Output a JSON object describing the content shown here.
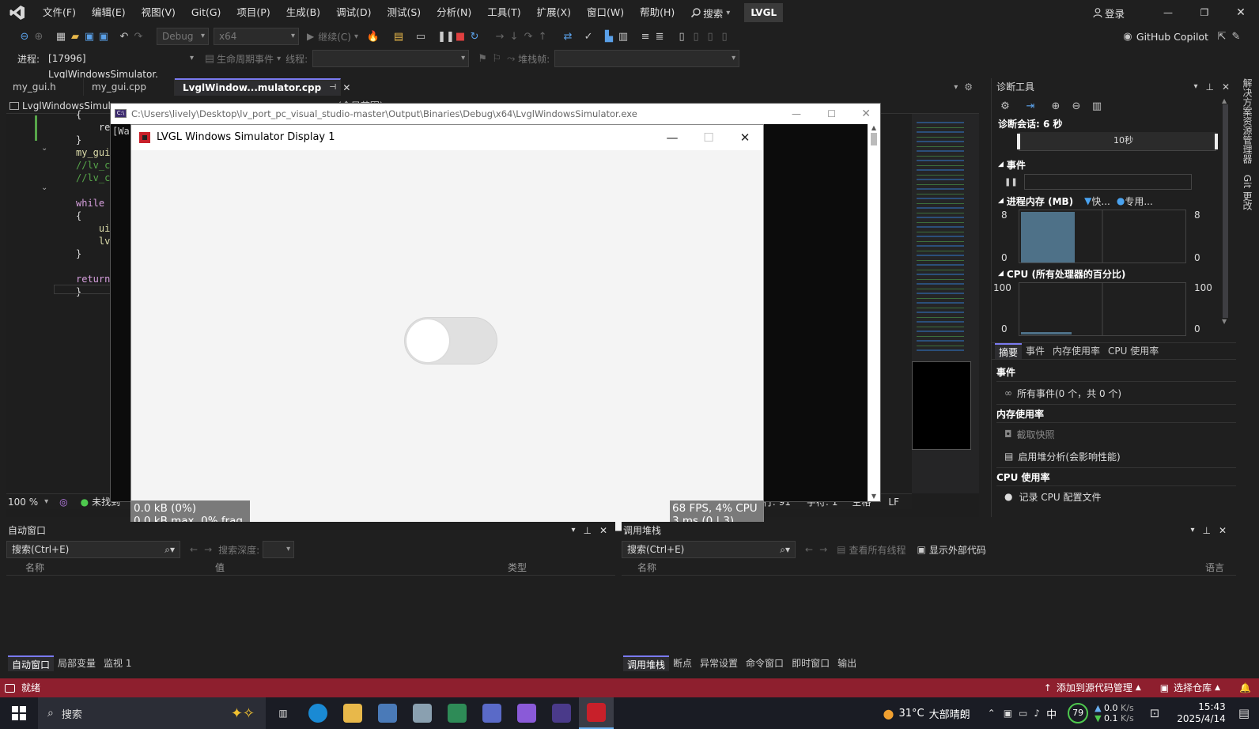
{
  "titlebar": {
    "menus": [
      "文件(F)",
      "编辑(E)",
      "视图(V)",
      "Git(G)",
      "项目(P)",
      "生成(B)",
      "调试(D)",
      "测试(S)",
      "分析(N)",
      "工具(T)",
      "扩展(X)",
      "窗口(W)",
      "帮助(H)"
    ],
    "search_label": "搜索",
    "solution_badge": "LVGL",
    "login_label": "登录"
  },
  "toolbar": {
    "config": "Debug",
    "platform": "x64",
    "continue_label": "继续(C)",
    "copilot_label": "GitHub Copilot"
  },
  "debugbar": {
    "process_label": "进程:",
    "process_value": "[17996] LvglWindowsSimulator.",
    "lifecycle_label": "生命周期事件",
    "thread_label": "线程:",
    "stackframe_label": "堆栈帧:"
  },
  "tabs": [
    {
      "label": "my_gui.h"
    },
    {
      "label": "my_gui.cpp"
    },
    {
      "label": "LvglWindow...mulator.cpp"
    }
  ],
  "editor": {
    "nav_project": "LvglWindowsSimula",
    "nav_scope": "(全局范围)",
    "code_lines": [
      "{",
      "    re",
      "}",
      "my_gui",
      "//lv_c",
      "//lv_c",
      "",
      "while",
      "{",
      "    ui",
      "    lv",
      "}",
      "",
      "return",
      "}"
    ],
    "zoom": "100 %",
    "status_text": "未找到",
    "line_info": "行: 91",
    "col_info": "字符: 1",
    "space_info": "空格",
    "eol_info": "LF"
  },
  "console": {
    "title": "C:\\Users\\lively\\Desktop\\lv_port_pc_visual_studio-master\\Output\\Binaries\\Debug\\x64\\LvglWindowsSimulator.exe",
    "first_line": "[War"
  },
  "lvgl": {
    "title": "LVGL Windows Simulator Display 1",
    "mem_line1": "0.0 kB (0%)",
    "mem_line2": "0.0 kB max, 0% frag.",
    "perf_line1": "68 FPS, 4% CPU",
    "perf_line2": "3 ms (0 | 3)",
    "switch_checked": false
  },
  "diagnostics": {
    "title": "诊断工具",
    "session": "诊断会话: 6 秒",
    "timeline_label": "10秒",
    "events_label": "事件",
    "memory_label": "进程内存 (MB)",
    "memory_legend1": "快...",
    "memory_legend2": "专用...",
    "memory_max": "8",
    "memory_min": "0",
    "cpu_label": "CPU (所有处理器的百分比)",
    "cpu_max": "100",
    "cpu_min": "0",
    "tabs": [
      "摘要",
      "事件",
      "内存使用率",
      "CPU 使用率"
    ],
    "summary_events_header": "事件",
    "summary_events_item": "所有事件(0 个，共 0 个)",
    "summary_memory_header": "内存使用率",
    "summary_snapshot": "截取快照",
    "summary_heap": "启用堆分析(会影响性能)",
    "summary_cpu_header": "CPU 使用率",
    "summary_cpu_record": "记录 CPU 配置文件"
  },
  "side_tabs": [
    "解决方案资源管理器",
    "Git 更改"
  ],
  "autos": {
    "title": "自动窗口",
    "search_placeholder": "搜索(Ctrl+E)",
    "depth_label": "搜索深度:",
    "columns": [
      "名称",
      "值",
      "类型"
    ],
    "bottom_tabs": [
      "自动窗口",
      "局部变量",
      "监视 1"
    ]
  },
  "callstack": {
    "title": "调用堆栈",
    "search_placeholder": "搜索(Ctrl+E)",
    "all_threads": "查看所有线程",
    "external_code": "显示外部代码",
    "columns": [
      "名称",
      "语言"
    ],
    "bottom_tabs": [
      "调用堆栈",
      "断点",
      "异常设置",
      "命令窗口",
      "即时窗口",
      "输出"
    ]
  },
  "statusbar": {
    "ready": "就绪",
    "add_source": "添加到源代码管理",
    "select_repo": "选择仓库"
  },
  "taskbar": {
    "search_label": "搜索",
    "weather_temp": "31°C",
    "weather_desc": "大部晴朗",
    "ime": "中",
    "battery": "79",
    "net_up": "0.0",
    "net_down": "0.1",
    "net_unit": "K/s",
    "time": "15:43",
    "date": "2025/4/14"
  },
  "colors": {
    "accent": "#7a7af0",
    "status_bar": "#8e1f2e",
    "memory_fill": "#4e7188"
  }
}
